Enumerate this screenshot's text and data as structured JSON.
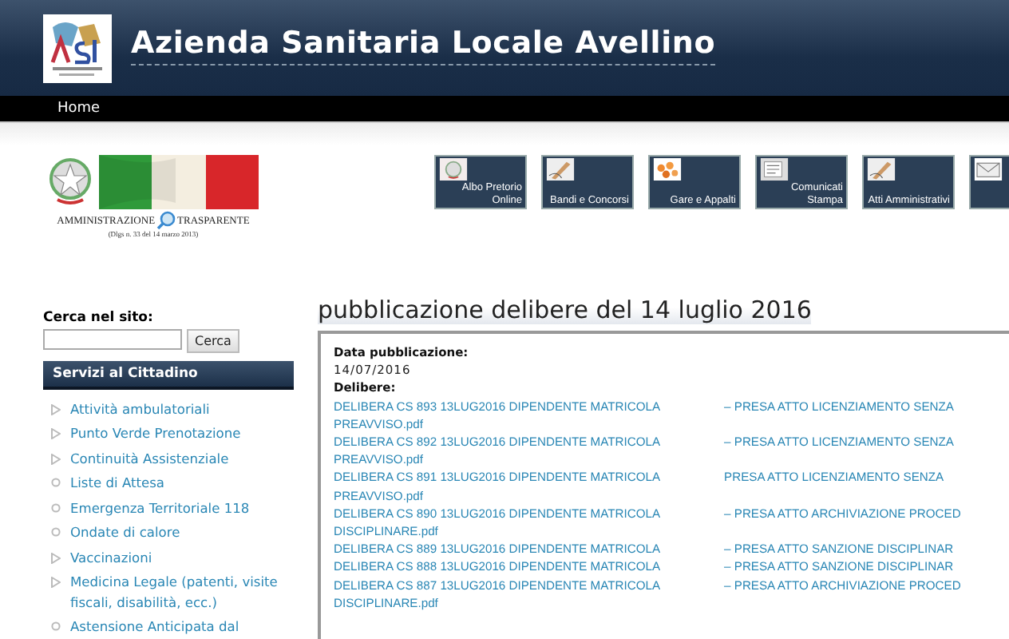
{
  "header": {
    "title": "Azienda Sanitaria Locale Avellino"
  },
  "nav": [
    {
      "label": "Home",
      "selected": false
    }
  ],
  "transparency_banner": {
    "label": "AMMINISTRAZIONE",
    "label_2": "TRASPARENTE",
    "note": "(Dlgs n. 33 del 14 marzo 2013)"
  },
  "toolbar": [
    {
      "label": "Albo Pretorio Online",
      "kind": "emblem"
    },
    {
      "label": "Bandi e Concorsi",
      "kind": "pen"
    },
    {
      "label": "Gare e Appalti",
      "kind": "pills"
    },
    {
      "label": "Comunicati Stampa",
      "kind": "papers"
    },
    {
      "label": "Atti Amministrativi",
      "kind": "pen"
    },
    {
      "kind": "envelope"
    }
  ],
  "search": {
    "label": "Cerca nel sito:",
    "button": "Cerca"
  },
  "sidebar": {
    "title": "Servizi al Cittadino",
    "items": [
      {
        "label": "Attività ambulatoriali",
        "kind": "submenu"
      },
      {
        "label": "Punto Verde Prenotazione",
        "kind": "submenu"
      },
      {
        "label": "Continuità Assistenziale",
        "kind": "submenu"
      },
      {
        "label": "Liste di Attesa",
        "kind": "page"
      },
      {
        "label": "Emergenza Territoriale 118",
        "kind": "page"
      },
      {
        "label": "Ondate di calore",
        "kind": "page"
      },
      {
        "label": "Vaccinazioni",
        "kind": "submenu"
      },
      {
        "label": "Medicina Legale (patenti, visite fiscali, disabilità, ecc.)",
        "kind": "submenu"
      },
      {
        "label": "Astensione Anticipata dal",
        "kind": "page"
      }
    ]
  },
  "page_title": "pubblicazione delibere del 14 luglio 2016",
  "content": {
    "date_label": "Data pubblicazione:",
    "date": "14/07/2016",
    "list_label": "Delibere:",
    "files": [
      {
        "text": "DELIBERA CS 893 13LUG2016 DIPENDENTE MATRICOLA",
        "text_2": "– PRESA ATTO LICENZIAMENTO SENZA",
        "text_3": "PREAVVISO.pdf"
      },
      {
        "text": "DELIBERA CS 892 13LUG2016 DIPENDENTE MATRICOLA",
        "text_2": "– PRESA ATTO LICENZIAMENTO SENZA",
        "text_3": "PREAVVISO.pdf"
      },
      {
        "text": "DELIBERA CS 891 13LUG2016 DIPENDENTE MATRICOLA",
        "text_2": "PRESA ATTO LICENZIAMENTO SENZA",
        "text_3": "PREAVVISO.pdf"
      },
      {
        "text": "DELIBERA CS 890 13LUG2016 DIPENDENTE MATRICOLA",
        "text_2": "– PRESA ATTO ARCHIVIAZIONE PROCED",
        "text_3": "DISCIPLINARE.pdf"
      },
      {
        "text": "DELIBERA CS 889 13LUG2016 DIPENDENTE MATRICOLA",
        "text_2": "– PRESA ATTO SANZIONE DISCIPLINAR"
      },
      {
        "text": "DELIBERA CS 888 13LUG2016 DIPENDENTE MATRICOLA",
        "text_2": "– PRESA ATTO SANZIONE DISCIPLINAR"
      },
      {
        "text": "DELIBERA CS 887 13LUG2016 DIPENDENTE MATRICOLA",
        "text_2": "– PRESA ATTO ARCHIVIAZIONE PROCED",
        "text_3": "DISCIPLINARE.pdf"
      }
    ]
  }
}
